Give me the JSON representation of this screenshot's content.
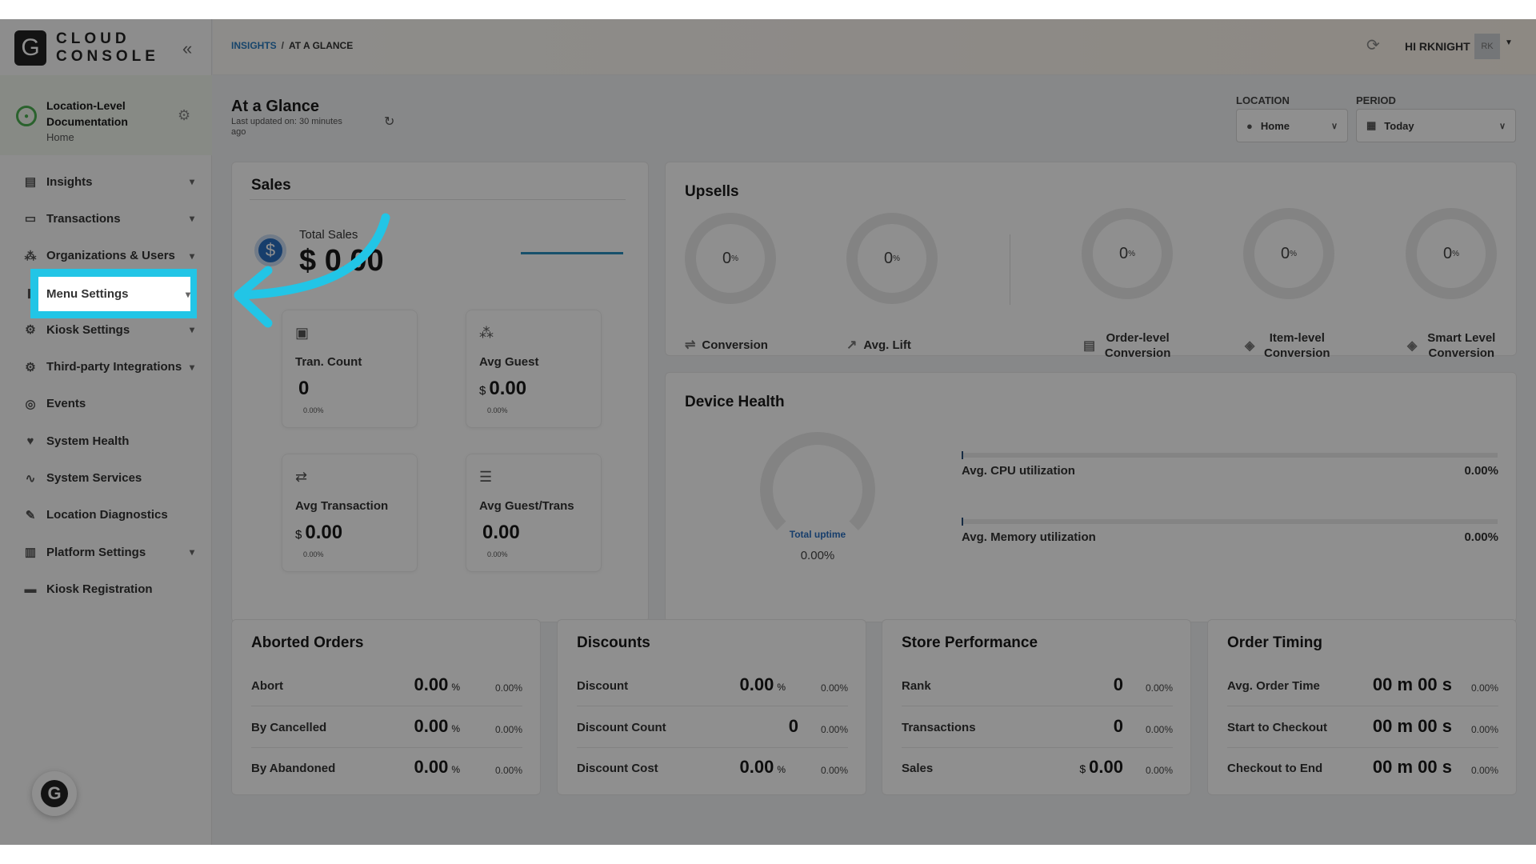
{
  "app": {
    "logo_letter": "G",
    "logo_line1": "CLOUD",
    "logo_line2": "CONSOLE"
  },
  "location_card": {
    "title": "Location-Level Documentation",
    "subtitle": "Home"
  },
  "sidebar": {
    "items": [
      {
        "label": "Insights",
        "icon": "chart-icon",
        "expandable": true
      },
      {
        "label": "Transactions",
        "icon": "receipt-icon",
        "expandable": true
      },
      {
        "label": "Organizations & Users",
        "icon": "org-icon",
        "expandable": true
      },
      {
        "label": "Menu Settings",
        "icon": "menu-icon",
        "expandable": true
      },
      {
        "label": "Kiosk Settings",
        "icon": "gear-icon",
        "expandable": true
      },
      {
        "label": "Third-party Integrations",
        "icon": "gear-icon",
        "expandable": true
      },
      {
        "label": "Events",
        "icon": "events-icon",
        "expandable": false
      },
      {
        "label": "System Health",
        "icon": "heart-icon",
        "expandable": false
      },
      {
        "label": "System Services",
        "icon": "pulse-icon",
        "expandable": false
      },
      {
        "label": "Location Diagnostics",
        "icon": "wrench-icon",
        "expandable": false
      },
      {
        "label": "Platform Settings",
        "icon": "doc-icon",
        "expandable": true
      },
      {
        "label": "Kiosk Registration",
        "icon": "kiosk-icon",
        "expandable": false
      }
    ],
    "fab_letter": "G"
  },
  "header": {
    "breadcrumb": [
      "INSIGHTS",
      "/",
      "AT A GLANCE"
    ],
    "greeting": "HI RKNIGHT",
    "avatar_initials": "RK"
  },
  "page": {
    "title": "At a Glance",
    "last_updated": "Last updated on: 30 minutes ago",
    "filters": {
      "location_label": "LOCATION",
      "location_value": "Home",
      "period_label": "PERIOD",
      "period_value": "Today"
    }
  },
  "sales": {
    "title": "Sales",
    "total_label": "Total Sales",
    "total_value": "$ 0.00",
    "tiles": [
      {
        "label": "Tran. Count",
        "currency": "",
        "value": "0",
        "pct": "0.00%"
      },
      {
        "label": "Avg Guest",
        "currency": "$",
        "value": "0.00",
        "pct": "0.00%"
      },
      {
        "label": "Avg Transaction",
        "currency": "$",
        "value": "0.00",
        "pct": "0.00%"
      },
      {
        "label": "Avg Guest/Trans",
        "currency": "",
        "value": "0.00",
        "pct": "0.00%"
      }
    ]
  },
  "upsells": {
    "title": "Upsells",
    "rings": [
      {
        "value": "0",
        "unit": "%",
        "label": "Conversion"
      },
      {
        "value": "0",
        "unit": "%",
        "label": "Avg. Lift"
      },
      {
        "value": "0",
        "unit": "%",
        "label": "Order-level Conversion"
      },
      {
        "value": "0",
        "unit": "%",
        "label": "Item-level Conversion"
      },
      {
        "value": "0",
        "unit": "%",
        "label": "Smart Level Conversion"
      }
    ]
  },
  "device_health": {
    "title": "Device Health",
    "uptime_label": "Total uptime",
    "uptime_value": "0.00%",
    "metrics": [
      {
        "label": "Avg. CPU utilization",
        "value": "0.00%",
        "fraction": 0
      },
      {
        "label": "Avg. Memory utilization",
        "value": "0.00%",
        "fraction": 0
      }
    ]
  },
  "aborted_orders": {
    "title": "Aborted Orders",
    "rows": [
      {
        "label": "Abort",
        "prefix": "",
        "value": "0.00",
        "unit": "%",
        "pct": "0.00%"
      },
      {
        "label": "By Cancelled",
        "prefix": "",
        "value": "0.00",
        "unit": "%",
        "pct": "0.00%"
      },
      {
        "label": "By Abandoned",
        "prefix": "",
        "value": "0.00",
        "unit": "%",
        "pct": "0.00%"
      }
    ]
  },
  "discounts": {
    "title": "Discounts",
    "rows": [
      {
        "label": "Discount",
        "prefix": "",
        "value": "0.00",
        "unit": "%",
        "pct": "0.00%"
      },
      {
        "label": "Discount Count",
        "prefix": "",
        "value": "0",
        "unit": "",
        "pct": "0.00%"
      },
      {
        "label": "Discount Cost",
        "prefix": "",
        "value": "0.00",
        "unit": "%",
        "pct": "0.00%"
      }
    ]
  },
  "store_performance": {
    "title": "Store Performance",
    "rows": [
      {
        "label": "Rank",
        "prefix": "",
        "value": "0",
        "unit": "",
        "pct": "0.00%"
      },
      {
        "label": "Transactions",
        "prefix": "",
        "value": "0",
        "unit": "",
        "pct": "0.00%"
      },
      {
        "label": "Sales",
        "prefix": "$",
        "value": "0.00",
        "unit": "",
        "pct": "0.00%"
      }
    ]
  },
  "order_timing": {
    "title": "Order Timing",
    "rows": [
      {
        "label": "Avg. Order Time",
        "prefix": "",
        "value": "00 m 00 s",
        "unit": "",
        "pct": "0.00%"
      },
      {
        "label": "Start to Checkout",
        "prefix": "",
        "value": "00 m 00 s",
        "unit": "",
        "pct": "0.00%"
      },
      {
        "label": "Checkout to End",
        "prefix": "",
        "value": "00 m 00 s",
        "unit": "",
        "pct": "0.00%"
      }
    ]
  },
  "colors": {
    "accent": "#22c5e6",
    "link": "#2a7bbf",
    "overlay": "rgba(0,0,0,0.44)"
  }
}
